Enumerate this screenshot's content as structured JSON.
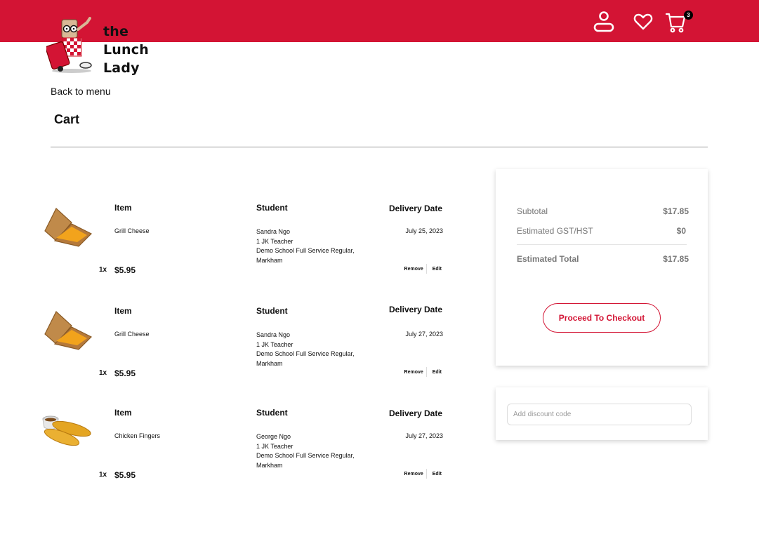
{
  "brand": {
    "logo_lines": [
      "the",
      "Lunch",
      "Lady"
    ],
    "primary_color": "#d31434"
  },
  "header": {
    "icons": [
      "user-icon",
      "heart-icon",
      "cart-icon"
    ],
    "cart_count": "3"
  },
  "nav": {
    "back_label": "Back to menu"
  },
  "page": {
    "title": "Cart"
  },
  "columns": {
    "item": "Item",
    "student": "Student",
    "delivery_date": "Delivery Date"
  },
  "items": [
    {
      "image": "grilled-cheese",
      "name": "Grill Cheese",
      "student_name": "Sandra Ngo",
      "class": "1 JK Teacher",
      "school": "Demo School Full Service Regular, Markham",
      "delivery_date": "July 25, 2023",
      "quantity": "1x",
      "price": "$5.95",
      "remove_label": "Remove",
      "edit_label": "Edit"
    },
    {
      "image": "grilled-cheese",
      "name": "Grill Cheese",
      "student_name": "Sandra Ngo",
      "class": "1 JK Teacher",
      "school": "Demo School Full Service Regular, Markham",
      "delivery_date": "July 27, 2023",
      "quantity": "1x",
      "price": "$5.95",
      "remove_label": "Remove",
      "edit_label": "Edit"
    },
    {
      "image": "chicken-fingers",
      "name": "Chicken Fingers",
      "student_name": "George Ngo",
      "class": "1 JK Teacher",
      "school": "Demo School Full Service Regular, Markham",
      "delivery_date": "July 27, 2023",
      "quantity": "1x",
      "price": "$5.95",
      "remove_label": "Remove",
      "edit_label": "Edit"
    }
  ],
  "summary": {
    "subtotal_label": "Subtotal",
    "subtotal_value": "$17.85",
    "tax_label": "Estimated GST/HST",
    "tax_value": "$0",
    "total_label": "Estimated Total",
    "total_value": "$17.85",
    "checkout_label": "Proceed To Checkout"
  },
  "discount": {
    "placeholder": "Add discount code",
    "value": ""
  }
}
